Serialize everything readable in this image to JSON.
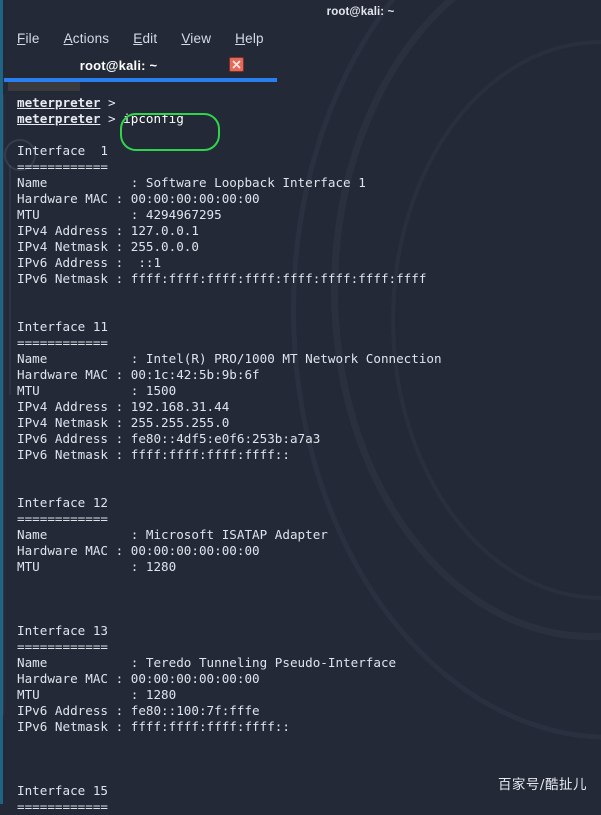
{
  "window": {
    "title": "root@kali: ~"
  },
  "menubar": {
    "items": [
      {
        "name": "file",
        "accel": "F",
        "rest": "ile"
      },
      {
        "name": "actions",
        "accel": "A",
        "rest": "ctions"
      },
      {
        "name": "edit",
        "accel": "E",
        "rest": "dit"
      },
      {
        "name": "view",
        "accel": "V",
        "rest": "iew"
      },
      {
        "name": "help",
        "accel": "H",
        "rest": "elp"
      }
    ]
  },
  "tab": {
    "label": "root@kali: ~",
    "close_icon": "close-icon"
  },
  "terminal": {
    "prompt_user": "meterpreter",
    "prompt_caret": ">",
    "highlighted_command": "ipconfig",
    "lines": [
      {
        "type": "prompt",
        "text": ""
      },
      {
        "type": "prompt",
        "text": "ipconfig"
      },
      {
        "type": "blank",
        "text": ""
      },
      {
        "type": "out",
        "text": "Interface  1"
      },
      {
        "type": "out",
        "text": "============"
      },
      {
        "type": "out",
        "text": "Name           : Software Loopback Interface 1"
      },
      {
        "type": "out",
        "text": "Hardware MAC : 00:00:00:00:00:00"
      },
      {
        "type": "out",
        "text": "MTU            : 4294967295"
      },
      {
        "type": "out",
        "text": "IPv4 Address : 127.0.0.1"
      },
      {
        "type": "out",
        "text": "IPv4 Netmask : 255.0.0.0"
      },
      {
        "type": "out",
        "text": "IPv6 Address :  ::1"
      },
      {
        "type": "out",
        "text": "IPv6 Netmask : ffff:ffff:ffff:ffff:ffff:ffff:ffff:ffff"
      },
      {
        "type": "blank",
        "text": ""
      },
      {
        "type": "blank",
        "text": ""
      },
      {
        "type": "out",
        "text": "Interface 11"
      },
      {
        "type": "out",
        "text": "============"
      },
      {
        "type": "out",
        "text": "Name           : Intel(R) PRO/1000 MT Network Connection"
      },
      {
        "type": "out",
        "text": "Hardware MAC : 00:1c:42:5b:9b:6f"
      },
      {
        "type": "out",
        "text": "MTU            : 1500"
      },
      {
        "type": "out",
        "text": "IPv4 Address : 192.168.31.44"
      },
      {
        "type": "out",
        "text": "IPv4 Netmask : 255.255.255.0"
      },
      {
        "type": "out",
        "text": "IPv6 Address : fe80::4df5:e0f6:253b:a7a3"
      },
      {
        "type": "out",
        "text": "IPv6 Netmask : ffff:ffff:ffff:ffff::"
      },
      {
        "type": "blank",
        "text": ""
      },
      {
        "type": "blank",
        "text": ""
      },
      {
        "type": "out",
        "text": "Interface 12"
      },
      {
        "type": "out",
        "text": "============"
      },
      {
        "type": "out",
        "text": "Name           : Microsoft ISATAP Adapter"
      },
      {
        "type": "out",
        "text": "Hardware MAC : 00:00:00:00:00:00"
      },
      {
        "type": "out",
        "text": "MTU            : 1280"
      },
      {
        "type": "blank",
        "text": ""
      },
      {
        "type": "blank",
        "text": ""
      },
      {
        "type": "blank",
        "text": ""
      },
      {
        "type": "out",
        "text": "Interface 13"
      },
      {
        "type": "out",
        "text": "============"
      },
      {
        "type": "out",
        "text": "Name           : Teredo Tunneling Pseudo-Interface"
      },
      {
        "type": "out",
        "text": "Hardware MAC : 00:00:00:00:00:00"
      },
      {
        "type": "out",
        "text": "MTU            : 1280"
      },
      {
        "type": "out",
        "text": "IPv6 Address : fe80::100:7f:fffe"
      },
      {
        "type": "out",
        "text": "IPv6 Netmask : ffff:ffff:ffff:ffff::"
      },
      {
        "type": "blank",
        "text": ""
      },
      {
        "type": "blank",
        "text": ""
      },
      {
        "type": "blank",
        "text": ""
      },
      {
        "type": "out",
        "text": "Interface 15"
      },
      {
        "type": "out",
        "text": "============"
      }
    ]
  },
  "watermark": {
    "text": "百家号/酷扯儿"
  },
  "colors": {
    "background": "#232937",
    "text": "#dfe3ec",
    "tab_underline": "#2a7ff0",
    "annotation_green": "#2fd44a",
    "close_button": "#e46a5c",
    "left_edge": "#1f6d93"
  }
}
